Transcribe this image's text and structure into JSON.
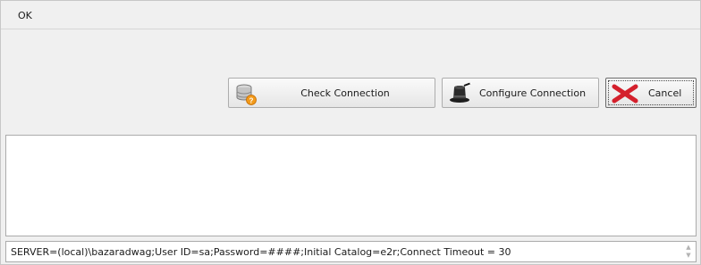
{
  "window": {
    "title": "OK"
  },
  "buttons": {
    "check_connection": "Check Connection",
    "configure_connection": "Configure Connection",
    "cancel": "Cancel"
  },
  "icons": {
    "check_connection": "database-question-icon",
    "configure_connection": "magic-hat-icon",
    "cancel": "red-x-icon"
  },
  "message": {
    "text": ""
  },
  "connection_string": {
    "value": "SERVER=(local)\\bazaradwag;User ID=sa;Password=####;Initial Catalog=e2r;Connect Timeout = 30"
  },
  "colors": {
    "cancel_icon": "#d4202c",
    "warning_badge": "#f29a1a"
  }
}
